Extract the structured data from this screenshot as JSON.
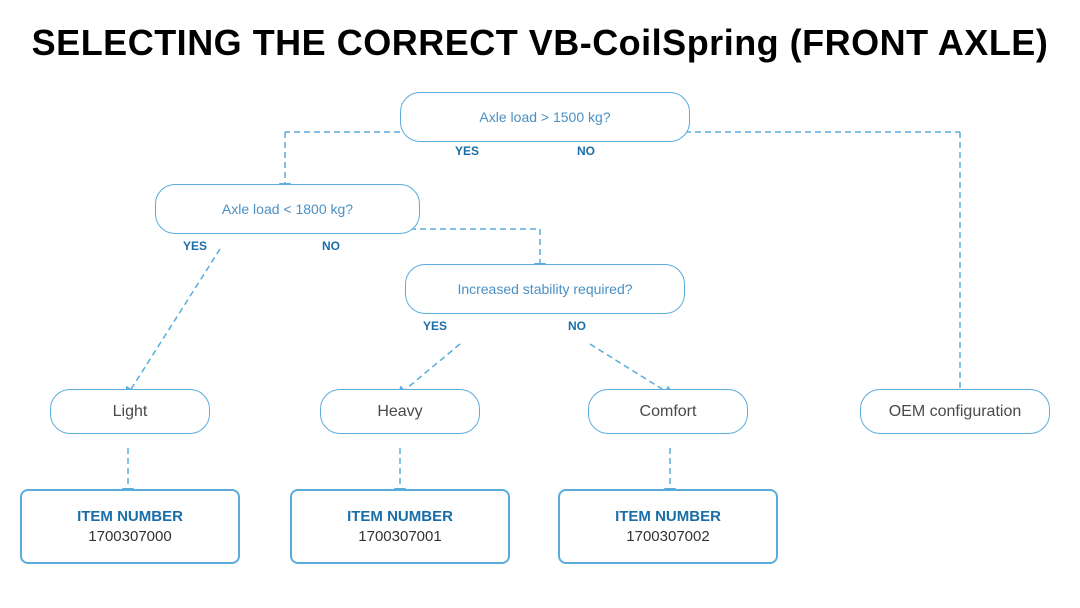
{
  "title": "SELECTING THE CORRECT VB-CoilSpring (FRONT AXLE)",
  "decision1": {
    "text": "Axle load > 1500 kg?",
    "yes": "YES",
    "no": "NO"
  },
  "decision2": {
    "text": "Axle load < 1800 kg?",
    "yes": "YES",
    "no": "NO"
  },
  "decision3": {
    "text": "Increased stability required?",
    "yes": "YES",
    "no": "NO"
  },
  "results": {
    "light": "Light",
    "heavy": "Heavy",
    "comfort": "Comfort",
    "oem": "OEM configuration"
  },
  "items": {
    "item0": {
      "label": "ITEM NUMBER",
      "number": "1700307000"
    },
    "item1": {
      "label": "ITEM NUMBER",
      "number": "1700307001"
    },
    "item2": {
      "label": "ITEM NUMBER",
      "number": "1700307002"
    }
  }
}
